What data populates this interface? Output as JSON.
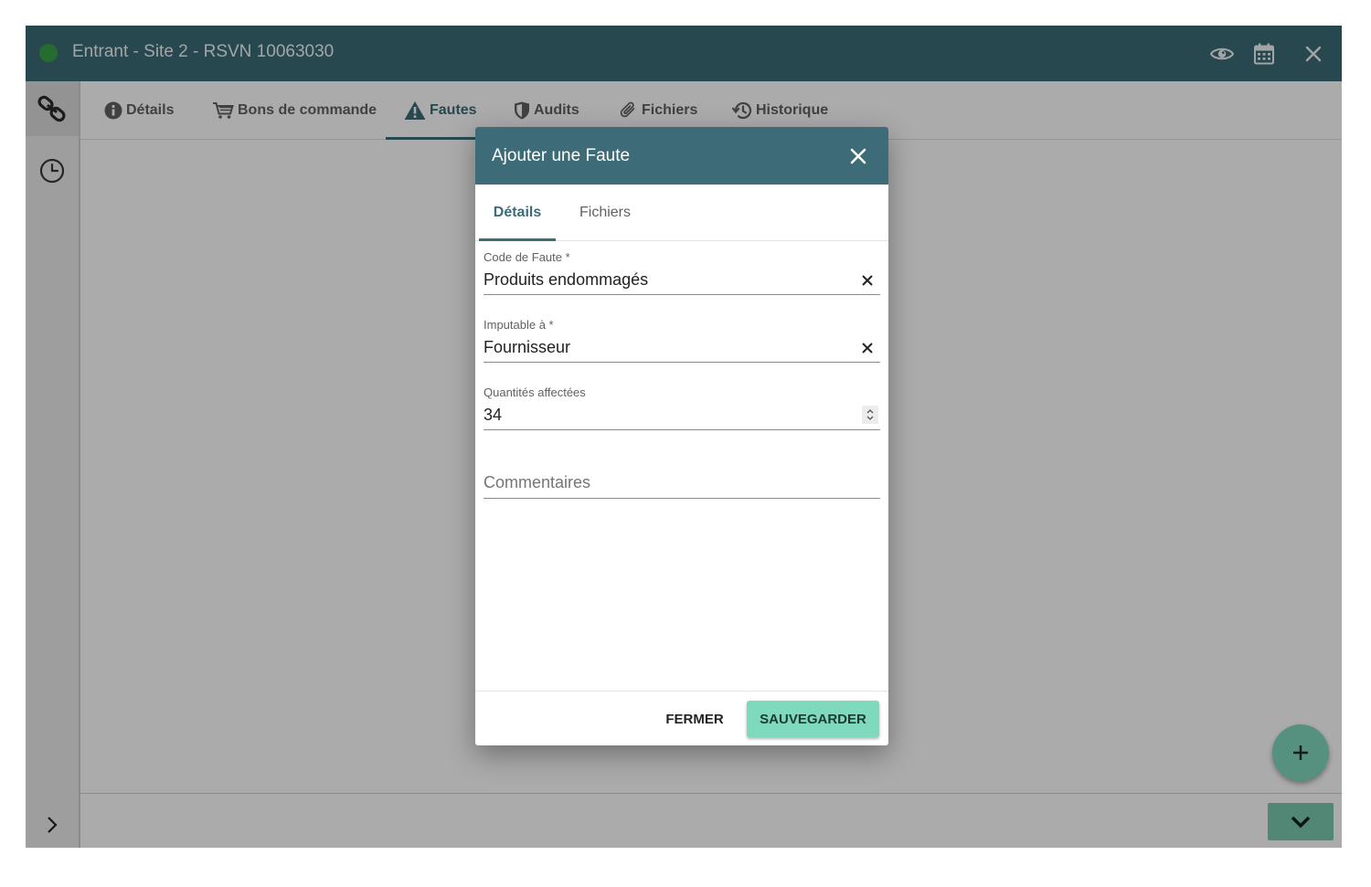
{
  "window": {
    "title": "Entrant - Site 2 - RSVN 10063030",
    "status_color": "#3aa047",
    "header_color": "#3d6c78",
    "actions": [
      {
        "icon": "eye-icon"
      },
      {
        "icon": "calendar-icon"
      },
      {
        "icon": "close-icon"
      }
    ]
  },
  "sidebar": {
    "items": [
      {
        "icon": "link-icon",
        "active": true
      },
      {
        "icon": "clock-icon",
        "active": false
      }
    ],
    "expand_icon": "chevron-right-icon"
  },
  "tabs": [
    {
      "label": "Détails",
      "icon": "info-circle-icon"
    },
    {
      "label": "Bons de commande",
      "icon": "cart-icon"
    },
    {
      "label": "Fautes",
      "icon": "warning-triangle-icon",
      "active": true
    },
    {
      "label": "Audits",
      "icon": "shield-icon"
    },
    {
      "label": "Fichiers",
      "icon": "paperclip-icon"
    },
    {
      "label": "Historique",
      "icon": "history-icon"
    }
  ],
  "modal": {
    "title": "Ajouter une Faute",
    "tabs": [
      {
        "label": "Détails",
        "active": true
      },
      {
        "label": "Fichiers",
        "active": false
      }
    ],
    "fields": {
      "code": {
        "label": "Code de Faute *",
        "value": "Produits endommagés"
      },
      "imputable": {
        "label": "Imputable à *",
        "value": "Fournisseur"
      },
      "quantity": {
        "label": "Quantités affectées",
        "value": "34"
      },
      "comments": {
        "placeholder": "Commentaires",
        "value": ""
      }
    },
    "buttons": {
      "close": "FERMER",
      "save": "SAUVEGARDER"
    }
  },
  "fab": {
    "icon": "plus-icon",
    "color": "#7fd9bd"
  },
  "collapse": {
    "icon": "chevron-down-icon"
  }
}
